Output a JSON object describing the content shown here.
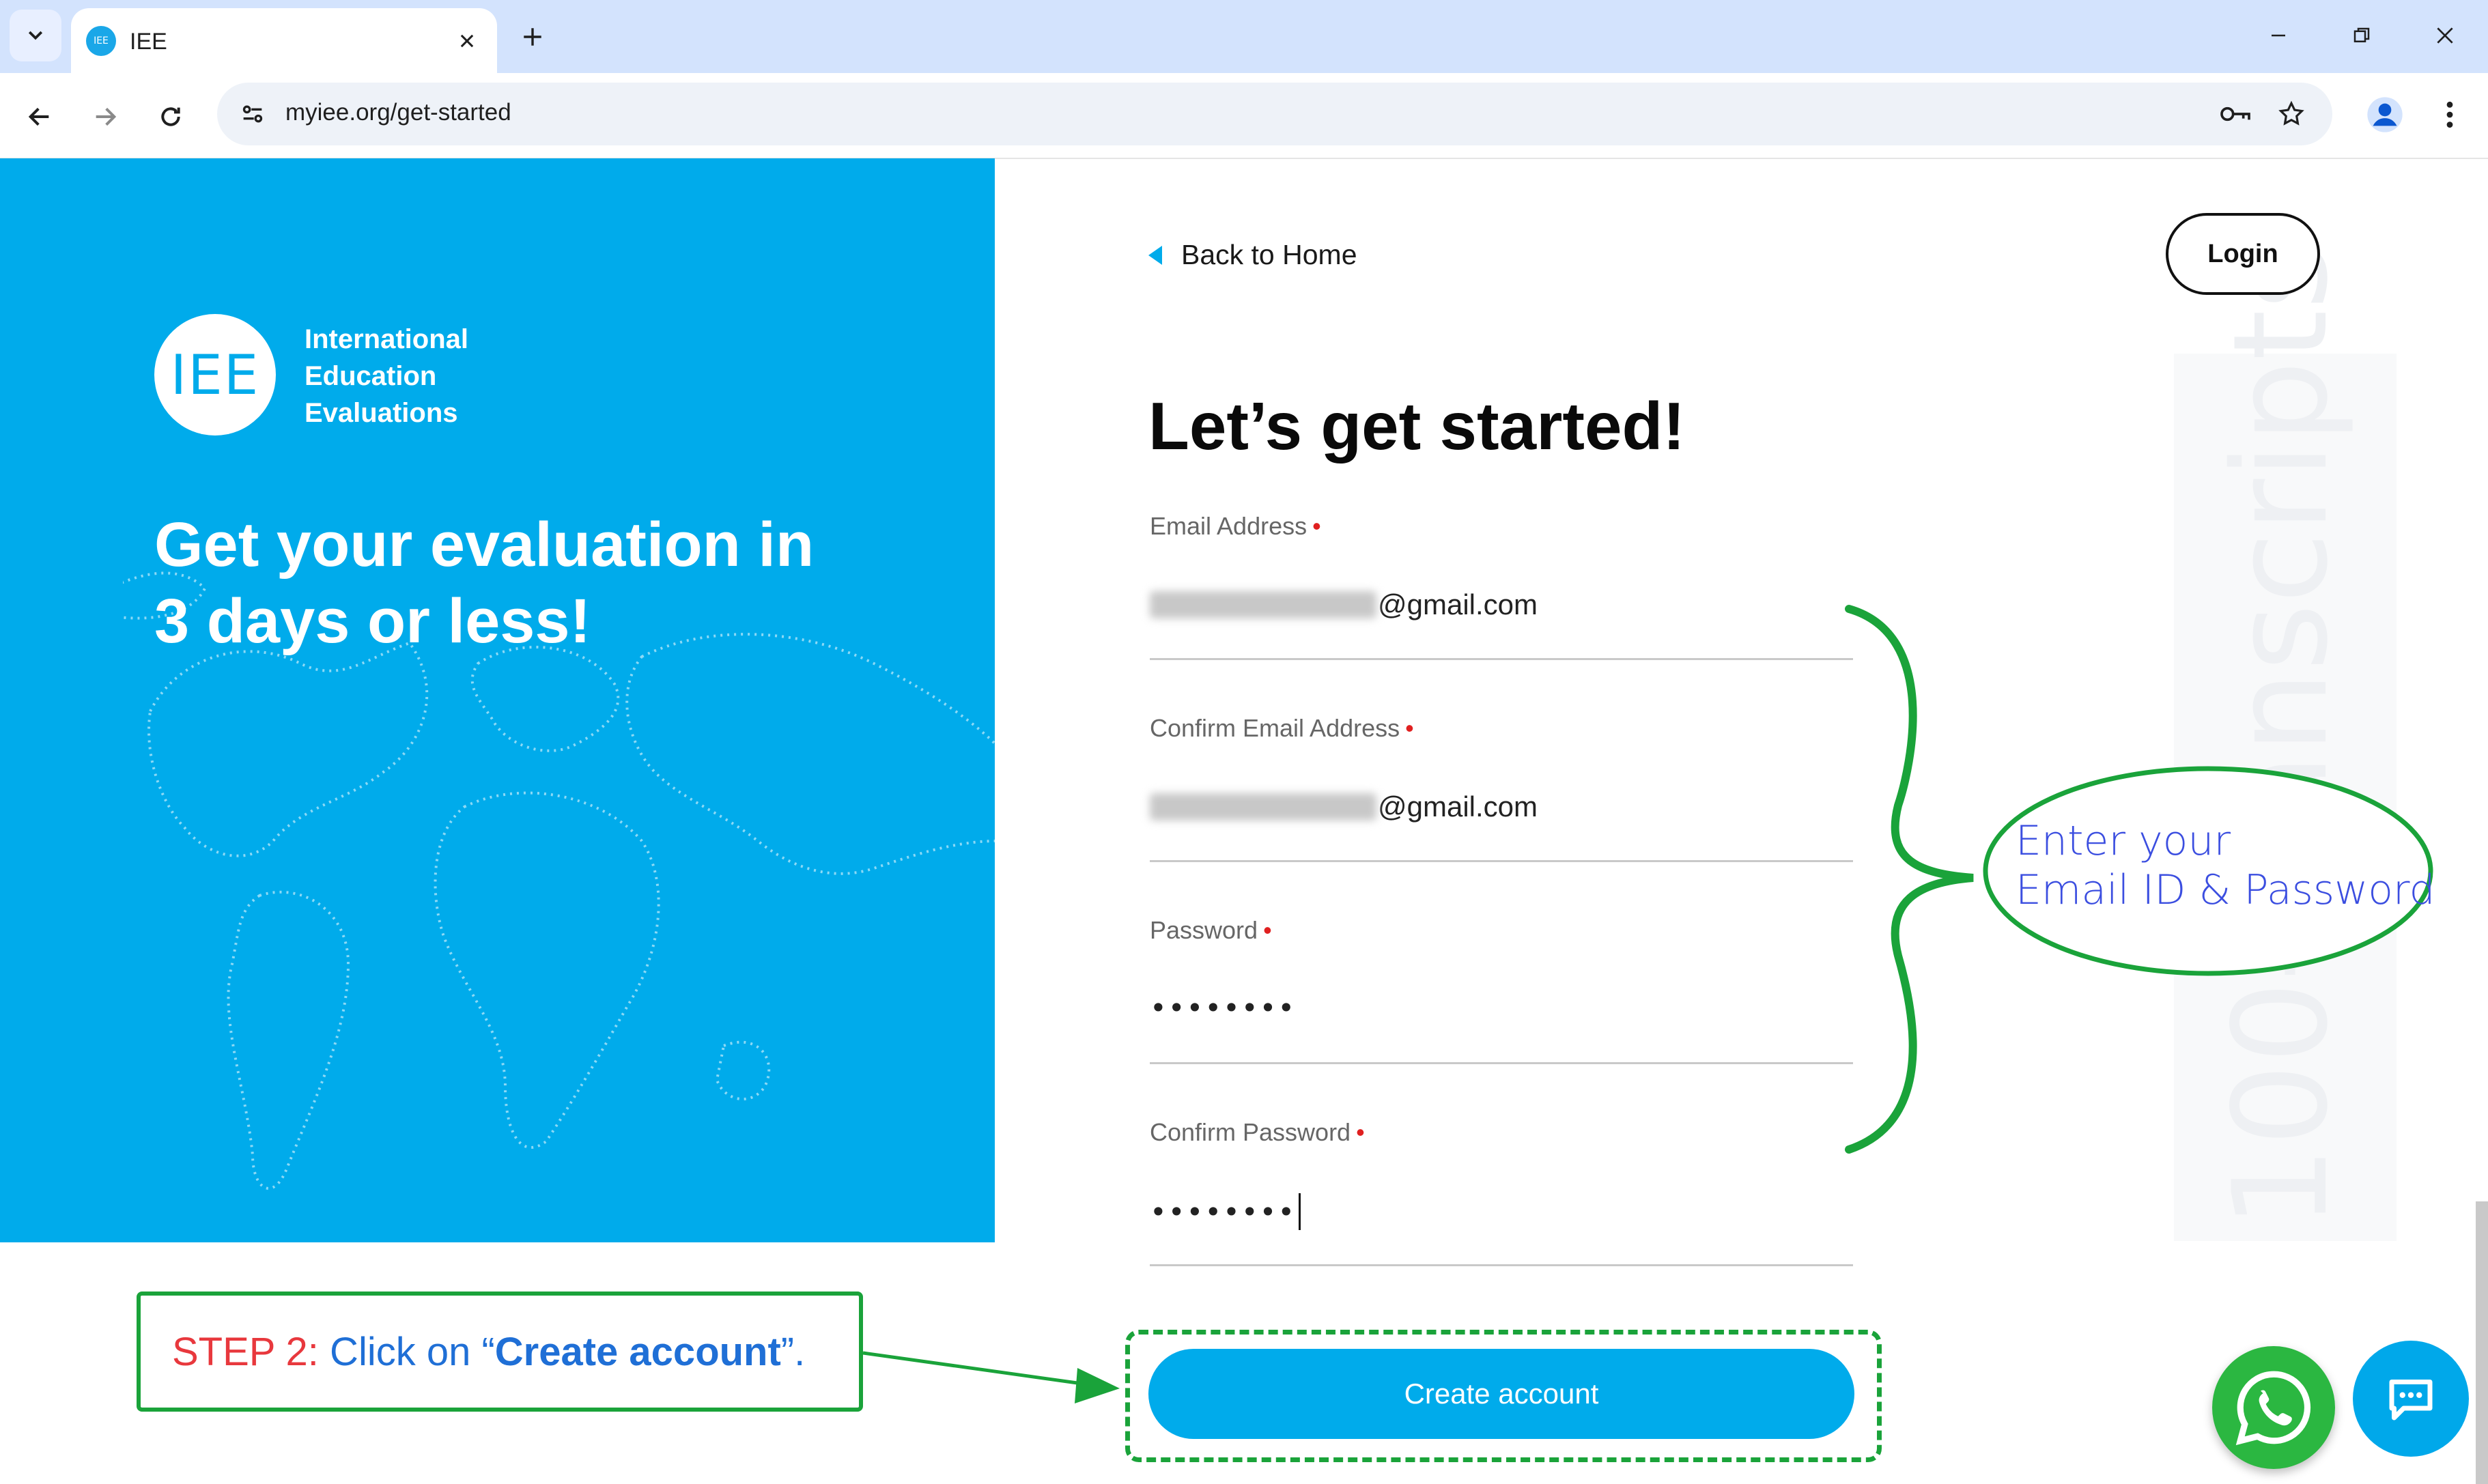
{
  "browser": {
    "tab_title": "IEE",
    "favicon_text": "IEE",
    "url": "myiee.org/get-started"
  },
  "hero": {
    "logo_mark": "IEE",
    "logo_line1": "International",
    "logo_line2": "Education",
    "logo_line3": "Evaluations",
    "headline_line1": "Get your evaluation in",
    "headline_line2": "3 days or less!"
  },
  "form": {
    "back_link": "Back to Home",
    "login_label": "Login",
    "title": "Let’s get started!",
    "email_label": "Email Address",
    "email_value_suffix": "@gmail.com",
    "confirm_email_label": "Confirm Email Address",
    "confirm_email_value_suffix": "@gmail.com",
    "password_label": "Password",
    "password_value": "••••••••",
    "confirm_password_label": "Confirm Password",
    "confirm_password_value": "••••••••",
    "required_mark": "•",
    "create_account_label": "Create account"
  },
  "annotation": {
    "step_prefix": "STEP 2:",
    "step_text": " Click on “",
    "step_highlight": "Create account",
    "step_suffix": "”.",
    "callout_line1": "Enter your",
    "callout_line2": "Email ID & Password",
    "watermark": "100-Transcripts"
  },
  "colors": {
    "brand_blue": "#00abeb",
    "annotation_green": "#1aa33a",
    "required_red": "#e02020"
  },
  "icons": [
    "tab-search-icon",
    "close-icon",
    "plus-icon",
    "minimize-icon",
    "restore-icon",
    "window-close-icon",
    "back-arrow-icon",
    "forward-arrow-icon",
    "reload-icon",
    "site-settings-icon",
    "key-icon",
    "star-icon",
    "profile-icon",
    "more-vert-icon",
    "whatsapp-icon",
    "chat-icon"
  ]
}
